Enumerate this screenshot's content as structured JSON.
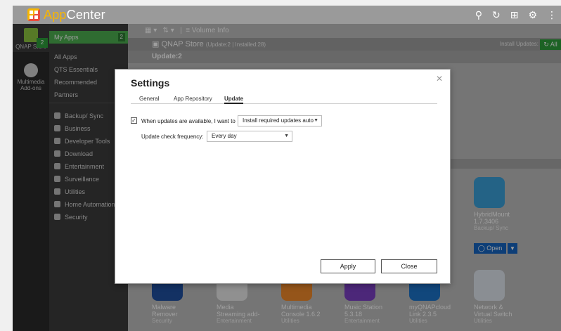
{
  "app": {
    "title_prefix": "App",
    "title_suffix": "Center"
  },
  "top_icons": [
    "search-icon",
    "refresh-icon",
    "install-icon",
    "gear-icon",
    "more-icon"
  ],
  "rail": [
    {
      "label": "QNAP Store",
      "badge": "2"
    },
    {
      "label": "Multimedia Add-ons"
    }
  ],
  "categories": {
    "my_apps": {
      "label": "My Apps",
      "count": "2"
    },
    "items": [
      "All Apps",
      "QTS Essentials",
      "Recommended",
      "Partners"
    ],
    "groups": [
      "Backup/ Sync",
      "Business",
      "Developer Tools",
      "Download",
      "Entertainment",
      "Surveillance",
      "Utilities",
      "Home Automation",
      "Security"
    ]
  },
  "toolbar": {
    "volume_label": "Volume Info"
  },
  "store": {
    "title": "QNAP Store",
    "subtitle": "(Update:2 | Installed:28)",
    "install_updates": "Install Updates:",
    "all_button": "All"
  },
  "update_header": "Update:2",
  "featured": {
    "name": "HybridMount",
    "version": "1.7.3406",
    "category": "Backup/ Sync",
    "open_label": "Open"
  },
  "tiles": [
    {
      "name": "Malware",
      "name2": "Remover",
      "category": "Security"
    },
    {
      "name": "Media",
      "name2": "Streaming add-",
      "category": "Entertainment"
    },
    {
      "name": "Multimedia",
      "name2": "Console 1.6.2",
      "category": "Utilities"
    },
    {
      "name": "Music Station",
      "name2": "5.3.18",
      "category": "Entertainment"
    },
    {
      "name": "myQNAPcloud",
      "name2": "Link 2.3.5",
      "category": "Utilities"
    },
    {
      "name": "Network &",
      "name2": "Virtual Switch",
      "category": "Utilities"
    }
  ],
  "dialog": {
    "title": "Settings",
    "tabs": [
      "General",
      "App Repository",
      "Update"
    ],
    "active_tab": "Update",
    "auto_update": {
      "checked": true,
      "label": "When updates are available, I want to",
      "value": "Install required updates auto"
    },
    "frequency": {
      "label": "Update check frequency:",
      "value": "Every day"
    },
    "apply_label": "Apply",
    "close_label": "Close"
  },
  "colors": {
    "accent_green": "#4caf50",
    "store_blue": "#1565c0",
    "brand_yellow": "#f7b500"
  }
}
